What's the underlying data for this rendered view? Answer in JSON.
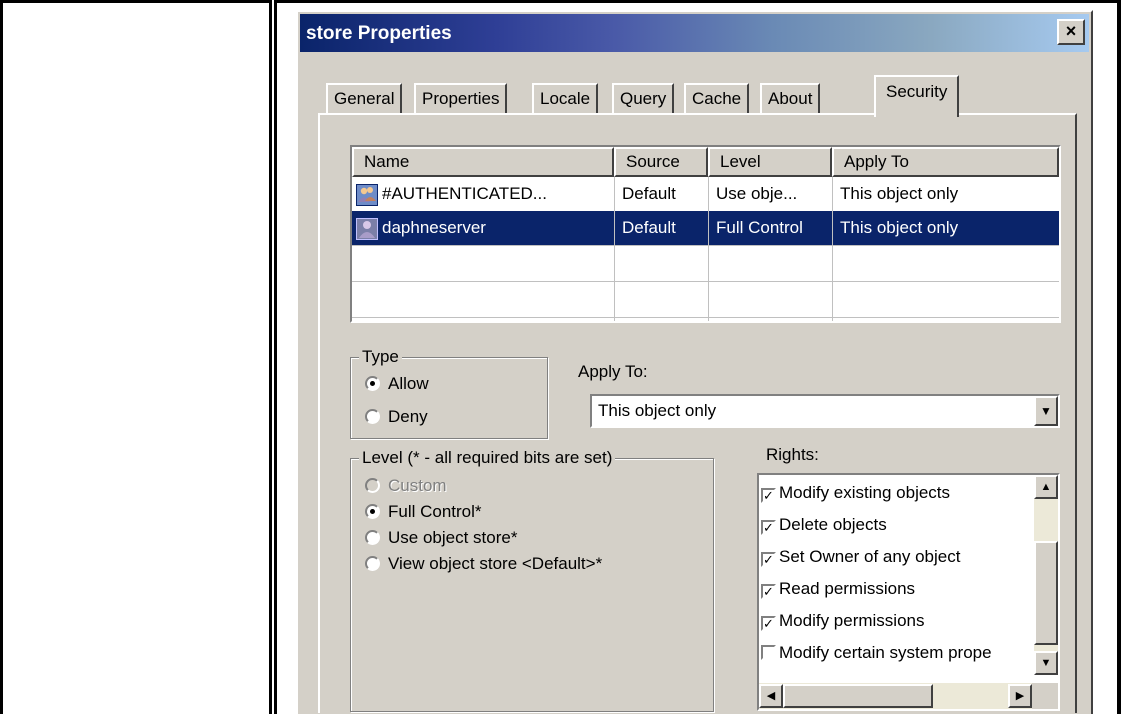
{
  "dialog": {
    "title": "store Properties",
    "close_label": "×"
  },
  "tabs": [
    {
      "label": "General"
    },
    {
      "label": "Properties"
    },
    {
      "label": "Locale"
    },
    {
      "label": "Query"
    },
    {
      "label": "Cache"
    },
    {
      "label": "About"
    },
    {
      "label": "Security",
      "active": true
    }
  ],
  "acl_list": {
    "columns": [
      "Name",
      "Source",
      "Level",
      "Apply To"
    ],
    "rows": [
      {
        "icon": "group-icon",
        "name": "#AUTHENTICATED...",
        "source": "Default",
        "level": "Use obje...",
        "apply_to": "This object only"
      },
      {
        "icon": "user-icon",
        "name": "daphneserver",
        "source": "Default",
        "level": "Full Control",
        "apply_to": "This object only",
        "selected": true
      }
    ]
  },
  "type_group": {
    "label": "Type",
    "options": [
      {
        "label": "Allow",
        "checked": true
      },
      {
        "label": "Deny",
        "checked": false
      }
    ]
  },
  "apply_to": {
    "label": "Apply To:",
    "value": "This object only"
  },
  "level_group": {
    "label": "Level (* - all required bits are set)",
    "options": [
      {
        "label": "Custom",
        "checked": false,
        "disabled": true
      },
      {
        "label": "Full Control*",
        "checked": true
      },
      {
        "label": "Use object store*",
        "checked": false
      },
      {
        "label": "View object store <Default>*",
        "checked": false
      }
    ]
  },
  "rights": {
    "label": "Rights:",
    "items": [
      {
        "label": "Modify existing objects",
        "checked": true
      },
      {
        "label": "Delete objects",
        "checked": true
      },
      {
        "label": "Set Owner of any object",
        "checked": true
      },
      {
        "label": "Read permissions",
        "checked": true
      },
      {
        "label": "Modify permissions",
        "checked": true
      },
      {
        "label": "Modify certain system prope",
        "checked": false
      }
    ]
  },
  "colors": {
    "face": "#d4d0c8",
    "selection": "#0a246a",
    "title_start": "#0a246a",
    "title_end": "#a6caf0"
  }
}
